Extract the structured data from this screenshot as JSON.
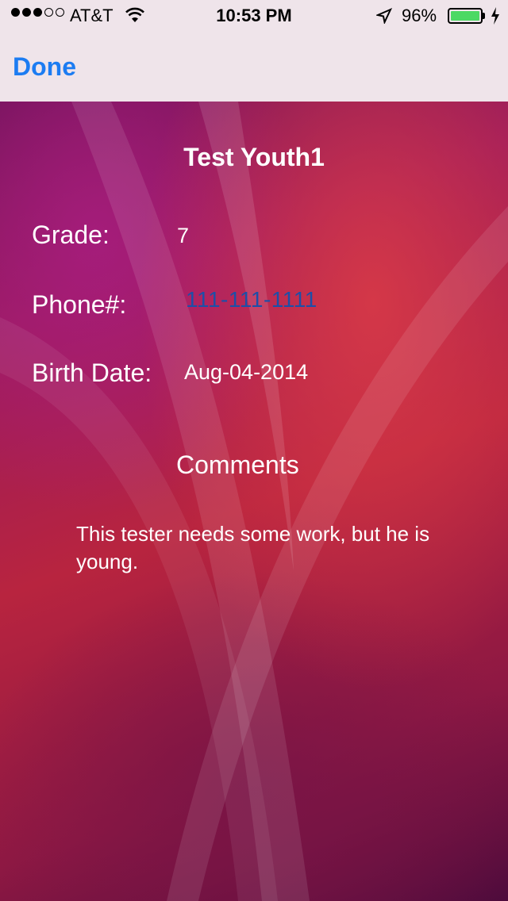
{
  "status_bar": {
    "carrier": "AT&T",
    "signal_bars_filled": 3,
    "signal_bars_total": 5,
    "time": "10:53 PM",
    "battery_percent": "96%",
    "icons": [
      "signal-dots-icon",
      "wifi-icon",
      "location-arrow-icon",
      "battery-icon",
      "charging-bolt-icon"
    ],
    "battery_color": "#4cd964"
  },
  "nav": {
    "done_label": "Done",
    "accent_color": "#1c7cf2"
  },
  "profile": {
    "name": "Test Youth1",
    "grade_label": "Grade:",
    "grade_value": "7",
    "phone_label": "Phone#:",
    "phone_value": "111-111-1111",
    "birth_label": "Birth Date:",
    "birth_value": "Aug-04-2014",
    "comments_title": "Comments",
    "comments_text": "This tester needs some work, but he is young."
  }
}
